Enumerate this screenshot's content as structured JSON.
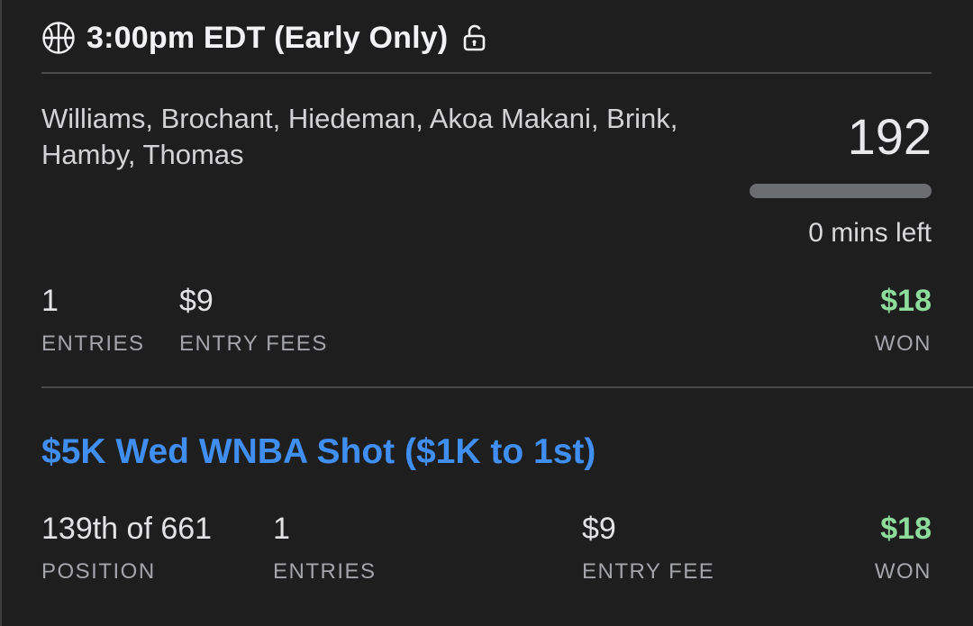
{
  "header": {
    "sport_icon": "basketball-icon",
    "title": "3:00pm EDT (Early Only)",
    "lock_icon": "unlocked-lock-icon"
  },
  "lineup": {
    "players": "Williams, Brochant, Hiedeman, Akoa Makani, Brink, Hamby, Thomas",
    "score": "192",
    "time_left": "0 mins left",
    "progress_fraction": 1.0
  },
  "summary": {
    "entries_value": "1",
    "entries_label": "ENTRIES",
    "fees_value": "$9",
    "fees_label": "ENTRY FEES",
    "won_value": "$18",
    "won_label": "WON"
  },
  "contest": {
    "title": "$5K Wed WNBA Shot ($1K to 1st)",
    "position_value": "139th of 661",
    "position_label": "POSITION",
    "entries_value": "1",
    "entries_label": "ENTRIES",
    "fee_value": "$9",
    "fee_label": "ENTRY FEE",
    "won_value": "$18",
    "won_label": "WON"
  },
  "colors": {
    "background": "#1e1e1f",
    "won_green": "#8ddc9b",
    "link_blue": "#3f8ef0",
    "progress_gray": "#6b6c70"
  }
}
